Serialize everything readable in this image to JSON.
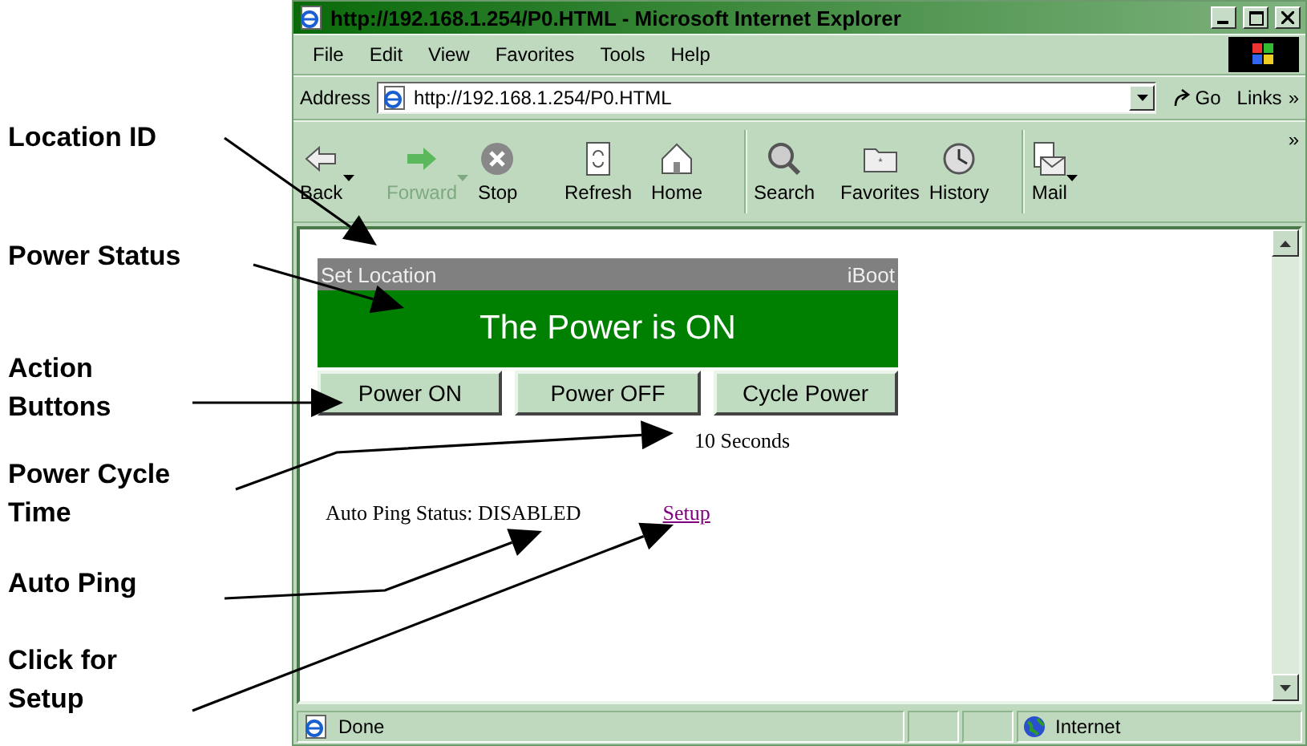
{
  "annotations": [
    {
      "text": "Location ID"
    },
    {
      "text": "Power Status"
    },
    {
      "text": "Action\nButtons"
    },
    {
      "text": "Power Cycle\nTime"
    },
    {
      "text": "Auto Ping"
    },
    {
      "text": "Click for\nSetup"
    }
  ],
  "window": {
    "title": "http://192.168.1.254/P0.HTML - Microsoft Internet Explorer"
  },
  "menu": [
    "File",
    "Edit",
    "View",
    "Favorites",
    "Tools",
    "Help"
  ],
  "address": {
    "label": "Address",
    "value": "http://192.168.1.254/P0.HTML",
    "go": "Go",
    "links": "Links",
    "more": "»"
  },
  "toolbar_more": "»",
  "toolbar": [
    {
      "kind": "back",
      "label": "Back",
      "disabled": false,
      "dropdown": true
    },
    {
      "kind": "forward",
      "label": "Forward",
      "disabled": true,
      "dropdown": true
    },
    {
      "kind": "stop",
      "label": "Stop",
      "disabled": false,
      "dropdown": false
    },
    {
      "kind": "refresh",
      "label": "Refresh",
      "disabled": false,
      "dropdown": false
    },
    {
      "kind": "home",
      "label": "Home",
      "disabled": false,
      "dropdown": false
    },
    {
      "kind": "search",
      "label": "Search",
      "disabled": false,
      "dropdown": false
    },
    {
      "kind": "favorites",
      "label": "Favorites",
      "disabled": false,
      "dropdown": false
    },
    {
      "kind": "history",
      "label": "History",
      "disabled": false,
      "dropdown": false
    },
    {
      "kind": "mail",
      "label": "Mail",
      "disabled": false,
      "dropdown": true
    }
  ],
  "page": {
    "header_left": "Set Location",
    "header_right": "iBoot",
    "status": "The Power is ON",
    "power_on": true,
    "buttons": [
      "Power ON",
      "Power OFF",
      "Cycle Power"
    ],
    "cycle_time": "10 Seconds",
    "auto_ping": "Auto Ping Status: DISABLED",
    "setup_link": "Setup"
  },
  "status_bar": {
    "text": "Done",
    "zone": "Internet"
  }
}
